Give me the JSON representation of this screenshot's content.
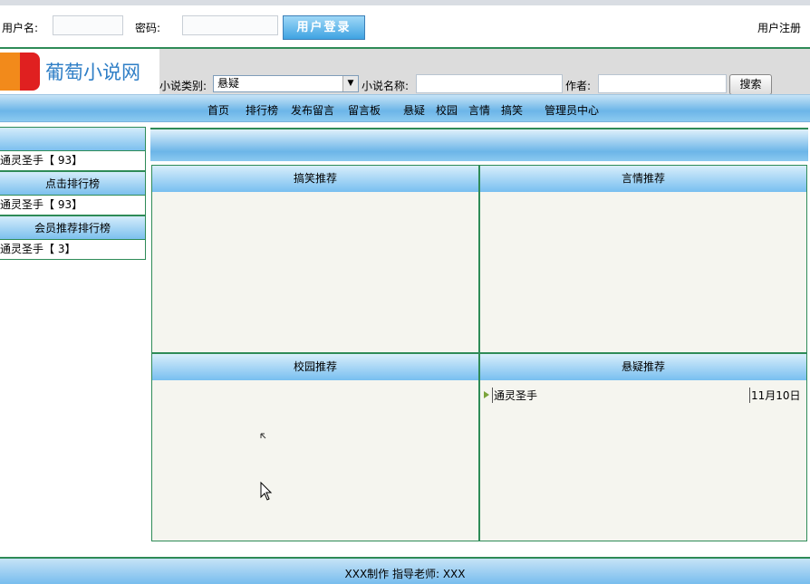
{
  "login": {
    "username_label": "用户名:",
    "password_label": "密码:",
    "login_button": "用户登录",
    "register_link": "用户注册"
  },
  "logo": {
    "text": "葡萄小说网"
  },
  "search": {
    "category_label": "小说类别:",
    "category_value": "悬疑",
    "name_label": "小说名称:",
    "author_label": "作者:",
    "search_button": "搜索"
  },
  "nav": [
    "首页",
    "排行榜",
    "发布留言",
    "留言板",
    "悬疑",
    "校园",
    "言情",
    "搞笑",
    "管理员中心"
  ],
  "sidebar": {
    "top_row": "通灵圣手【 93】",
    "click_rank_title": "点击排行榜",
    "click_rank_row": "通灵圣手【 93】",
    "member_rank_title": "会员推荐排行榜",
    "member_rank_row": "通灵圣手【 3】"
  },
  "panels": {
    "funny": {
      "title": "搞笑推荐"
    },
    "romance": {
      "title": "言情推荐"
    },
    "campus": {
      "title": "校园推荐"
    },
    "mystery": {
      "title": "悬疑推荐",
      "items": [
        {
          "name": "通灵圣手",
          "date": "11月10日"
        }
      ]
    }
  },
  "footer": {
    "text": "XXX制作 指导老师: XXX"
  }
}
